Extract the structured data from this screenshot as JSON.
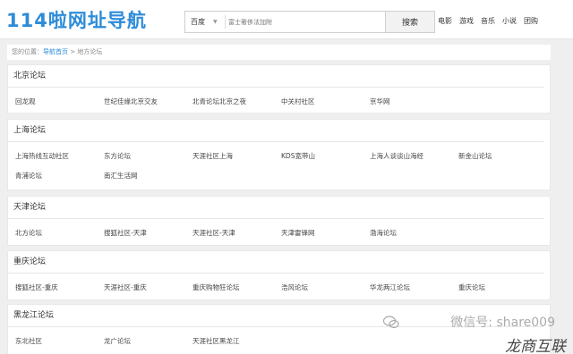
{
  "header": {
    "logo": "114啦网址导航",
    "search": {
      "engine": "百度",
      "placeholder": "富士奢侈法加附",
      "button": "搜索"
    },
    "nav": [
      "电影",
      "游戏",
      "音乐",
      "小说",
      "团购"
    ]
  },
  "breadcrumb": {
    "prefix": "您的位置：",
    "home": "导航首页",
    "separator": ">",
    "current": "地方论坛"
  },
  "sections": [
    {
      "title": "北京论坛",
      "rows": [
        [
          "回龙观",
          "世纪佳缘北京交友",
          "北青论坛北京之夜",
          "中关村社区",
          "京华网"
        ]
      ]
    },
    {
      "title": "上海论坛",
      "rows": [
        [
          "上海热线互动社区",
          "东方论坛",
          "天涯社区上海",
          "KDS宽带山",
          "上海人谈谈山海经",
          "新金山论坛"
        ],
        [
          "青浦论坛",
          "南汇生活网"
        ]
      ]
    },
    {
      "title": "天津论坛",
      "rows": [
        [
          "北方论坛",
          "搜狐社区-天津",
          "天涯社区-天津",
          "天津雷锋网",
          "渤海论坛"
        ]
      ]
    },
    {
      "title": "重庆论坛",
      "rows": [
        [
          "搜狐社区-重庆",
          "天涯社区-重庆",
          "重庆购物狂论坛",
          "浩风论坛",
          "华龙两江论坛",
          "重庆论坛"
        ]
      ]
    },
    {
      "title": "黑龙江论坛",
      "rows": [
        [
          "东北社区",
          "龙广论坛",
          "天涯社区黑龙江"
        ]
      ]
    }
  ],
  "watermark": {
    "line1": "微信号: share009",
    "line2": "龙商互联"
  }
}
